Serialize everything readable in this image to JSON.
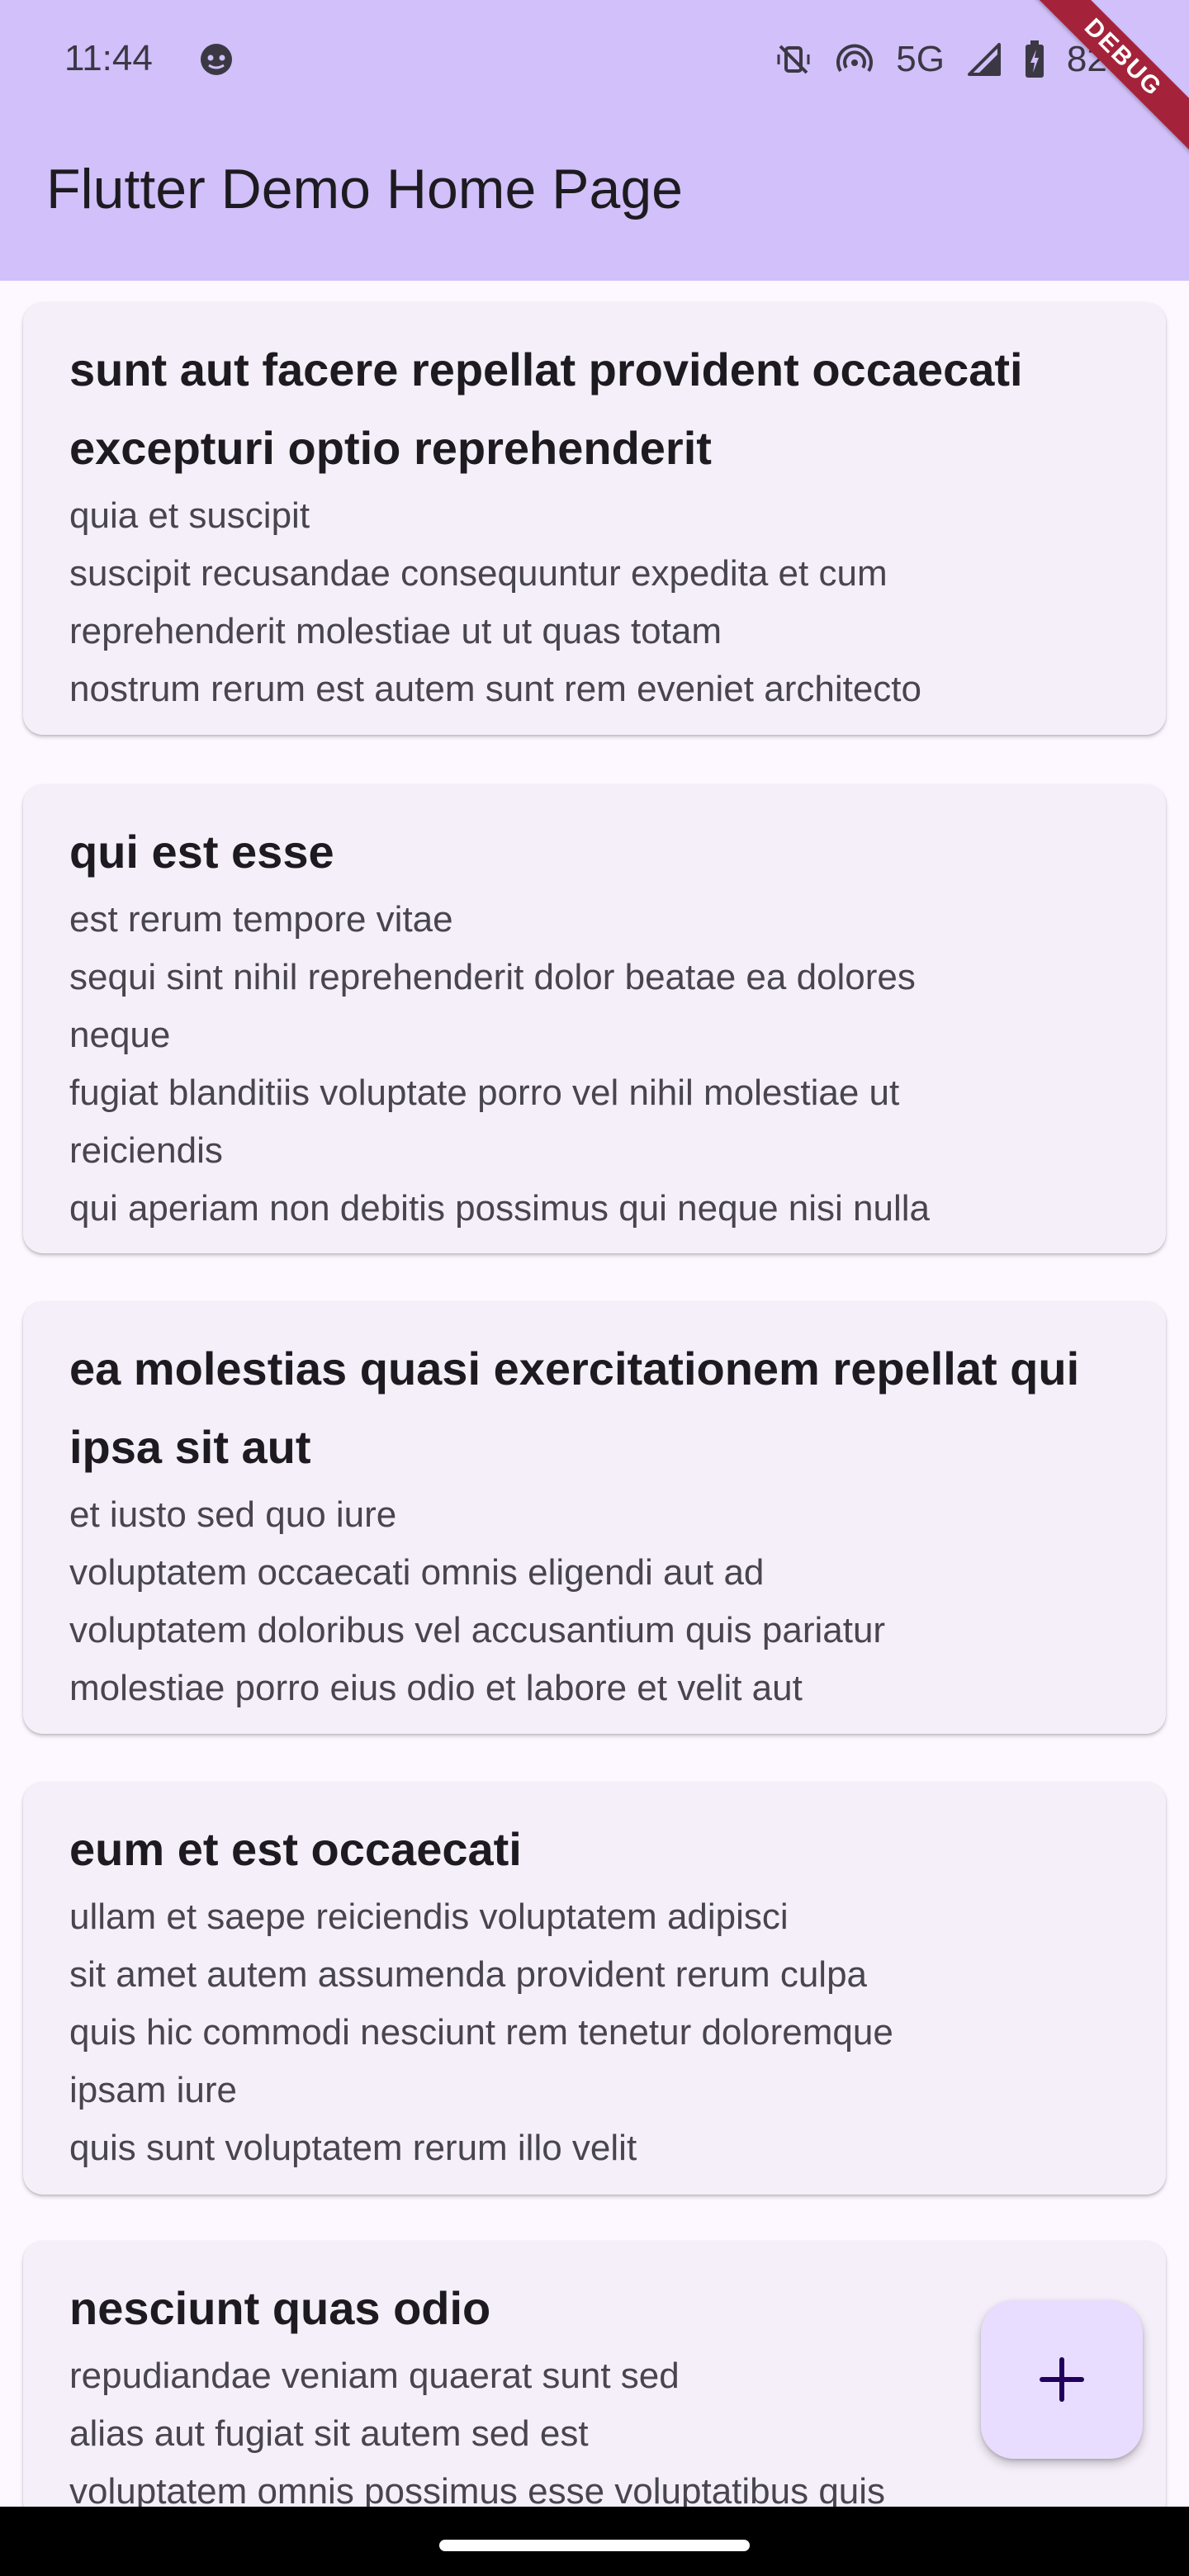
{
  "status_bar": {
    "time": "11:44",
    "network": "5G",
    "battery": "82%",
    "icons": [
      "face-icon",
      "vibrate-off-icon",
      "hotspot-icon",
      "signal-icon",
      "battery-charging-icon"
    ]
  },
  "debug_banner": {
    "label": "DEBUG",
    "color": "#a4233a"
  },
  "app_bar": {
    "title": "Flutter Demo Home Page",
    "background": "#d1c0f9"
  },
  "posts": [
    {
      "title": "sunt aut facere repellat provident occaecati excepturi optio reprehenderit",
      "body": "quia et suscipit\nsuscipit recusandae consequuntur expedita et cum\nreprehenderit molestiae ut ut quas totam\nnostrum rerum est autem sunt rem eveniet architecto"
    },
    {
      "title": "qui est esse",
      "body": "est rerum tempore vitae\nsequi sint nihil reprehenderit dolor beatae ea dolores\nneque\nfugiat blanditiis voluptate porro vel nihil molestiae ut\nreiciendis\nqui aperiam non debitis possimus qui neque nisi nulla"
    },
    {
      "title": "ea molestias quasi exercitationem repellat qui ipsa sit aut",
      "body": "et iusto sed quo iure\nvoluptatem occaecati omnis eligendi aut ad\nvoluptatem doloribus vel accusantium quis pariatur\nmolestiae porro eius odio et labore et velit aut"
    },
    {
      "title": "eum et est occaecati",
      "body": "ullam et saepe reiciendis voluptatem adipisci\nsit amet autem assumenda provident rerum culpa\nquis hic commodi nesciunt rem tenetur doloremque\nipsam iure\nquis sunt voluptatem rerum illo velit"
    },
    {
      "title": "nesciunt quas odio",
      "body": "repudiandae veniam quaerat sunt sed\nalias aut fugiat sit autem sed est\nvoluptatem omnis possimus esse voluptatibus quis"
    }
  ],
  "fab": {
    "icon": "add-icon",
    "background": "#e9ddff"
  },
  "colors": {
    "page_background": "#fdf7ff",
    "card_background": "#f5effa"
  }
}
